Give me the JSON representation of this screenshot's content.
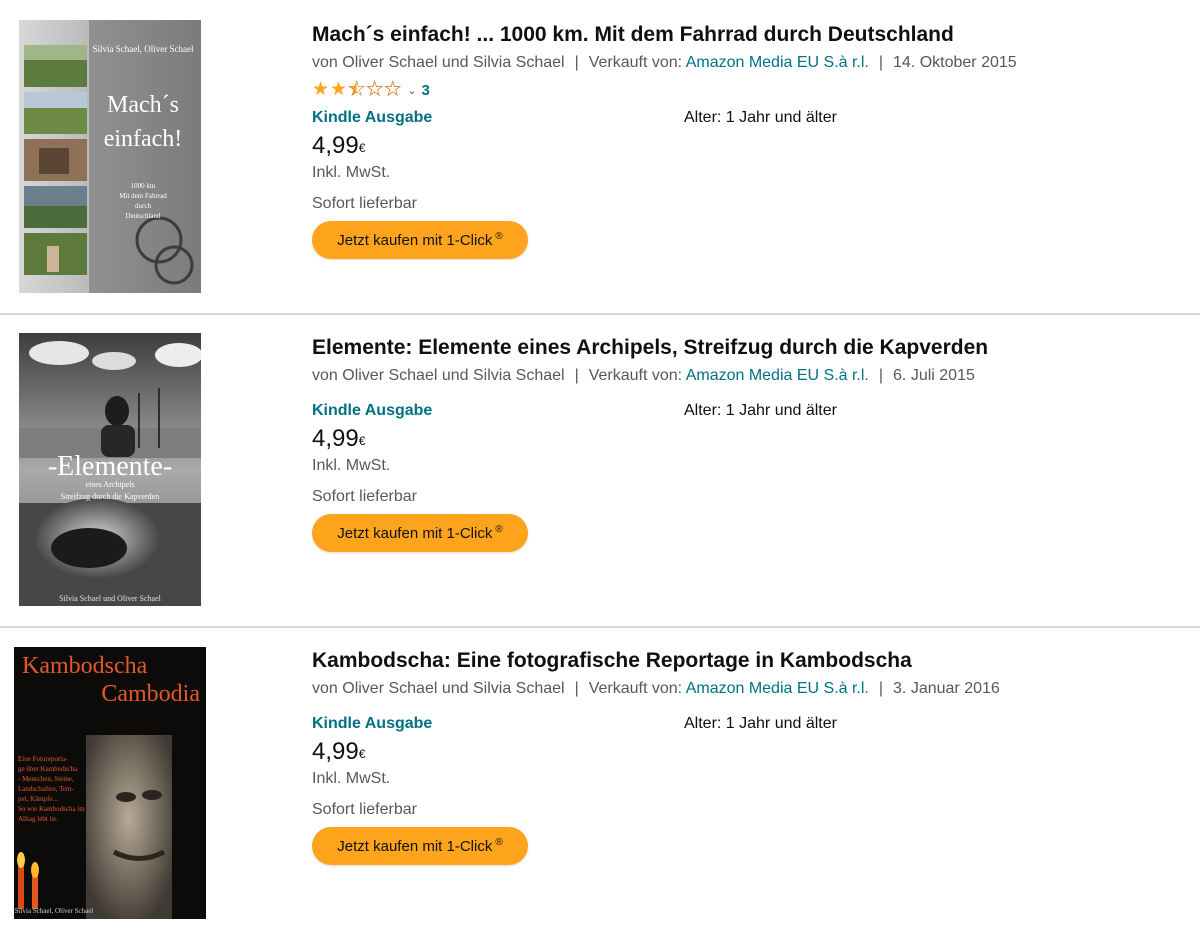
{
  "results": [
    {
      "title": "Mach´s einfach! ... 1000 km. Mit dem Fahrrad durch Deutschland",
      "byline_prefix": "von Oliver Schael und Silvia Schael",
      "sold_by_label": "Verkauft von:",
      "seller": "Amazon Media EU S.à r.l.",
      "date": "14. Oktober 2015",
      "rating": {
        "stars": 2.5,
        "out_of": 5,
        "count": "3"
      },
      "format": "Kindle Ausgabe",
      "age": "Alter: 1 Jahr und älter",
      "price": "4,99",
      "currency": "€",
      "vat": "Inkl. MwSt.",
      "availability": "Sofort lieferbar",
      "buy_label": "Jetzt kaufen mit 1-Click",
      "buy_mark": "®",
      "cover": {
        "authors": "Silvia Schael, Oliver Schael",
        "title_line1": "Mach´s",
        "title_line2": "einfach!",
        "subtitle_lines": [
          "1000 km",
          "Mit dem Fahrrad",
          "durch",
          "Deutschland"
        ]
      }
    },
    {
      "title": "Elemente: Elemente eines Archipels, Streifzug durch die Kapverden",
      "byline_prefix": "von Oliver Schael und Silvia Schael",
      "sold_by_label": "Verkauft von:",
      "seller": "Amazon Media EU S.à r.l.",
      "date": "6. Juli 2015",
      "format": "Kindle Ausgabe",
      "age": "Alter: 1 Jahr und älter",
      "price": "4,99",
      "currency": "€",
      "vat": "Inkl. MwSt.",
      "availability": "Sofort lieferbar",
      "buy_label": "Jetzt kaufen mit 1-Click",
      "buy_mark": "®",
      "cover": {
        "title": "-Elemente-",
        "subtitle_line1": "eines Archipels",
        "subtitle_line2": "Streifzug durch die Kapverden",
        "authors": "Silvia Schael und Oliver Schael"
      }
    },
    {
      "title": "Kambodscha: Eine fotografische Reportage in Kambodscha",
      "byline_prefix": "von Oliver Schael und Silvia Schael",
      "sold_by_label": "Verkauft von:",
      "seller": "Amazon Media EU S.à r.l.",
      "date": "3. Januar 2016",
      "format": "Kindle Ausgabe",
      "age": "Alter: 1 Jahr und älter",
      "price": "4,99",
      "currency": "€",
      "vat": "Inkl. MwSt.",
      "availability": "Sofort lieferbar",
      "buy_label": "Jetzt kaufen mit 1-Click",
      "buy_mark": "®",
      "cover": {
        "title_line1": "Kambodscha",
        "title_line2": "Cambodia",
        "blurb_lines": [
          "Eine Fotoreporta-",
          "ge über Kambodscha",
          "- Menschen, Steine,",
          "Landschaften, Tem-",
          "pel, Kämpfe...",
          "So wie Kambodscha im",
          "Alltag lebt ist."
        ],
        "authors": "Silvia Schael, Oliver Schael"
      }
    }
  ]
}
